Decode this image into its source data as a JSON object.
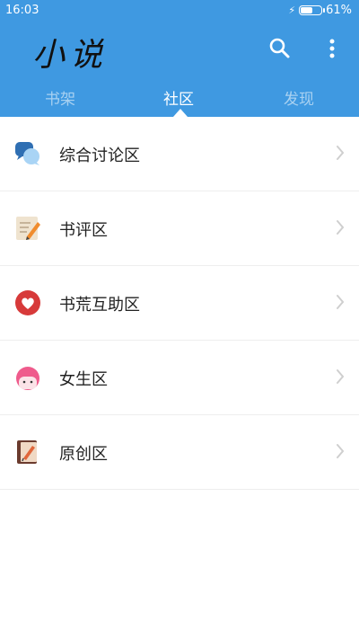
{
  "status_bar": {
    "time": "16:03",
    "battery": "61%",
    "battery_level": 0.61
  },
  "app_bar": {
    "title": "小说",
    "search_icon": "search-icon",
    "more_icon": "more-vertical-icon"
  },
  "tabs": [
    {
      "label": "书架",
      "active": false
    },
    {
      "label": "社区",
      "active": true
    },
    {
      "label": "发现",
      "active": false
    }
  ],
  "sections": [
    {
      "label": "综合讨论区",
      "icon": "chat-bubbles-icon"
    },
    {
      "label": "书评区",
      "icon": "review-pencil-icon"
    },
    {
      "label": "书荒互助区",
      "icon": "heart-icon"
    },
    {
      "label": "女生区",
      "icon": "girl-face-icon"
    },
    {
      "label": "原创区",
      "icon": "original-book-icon"
    }
  ],
  "colors": {
    "header": "#3f99e1",
    "text": "#222222",
    "divider": "#eeeeee",
    "chevron": "#cfcfcf"
  }
}
